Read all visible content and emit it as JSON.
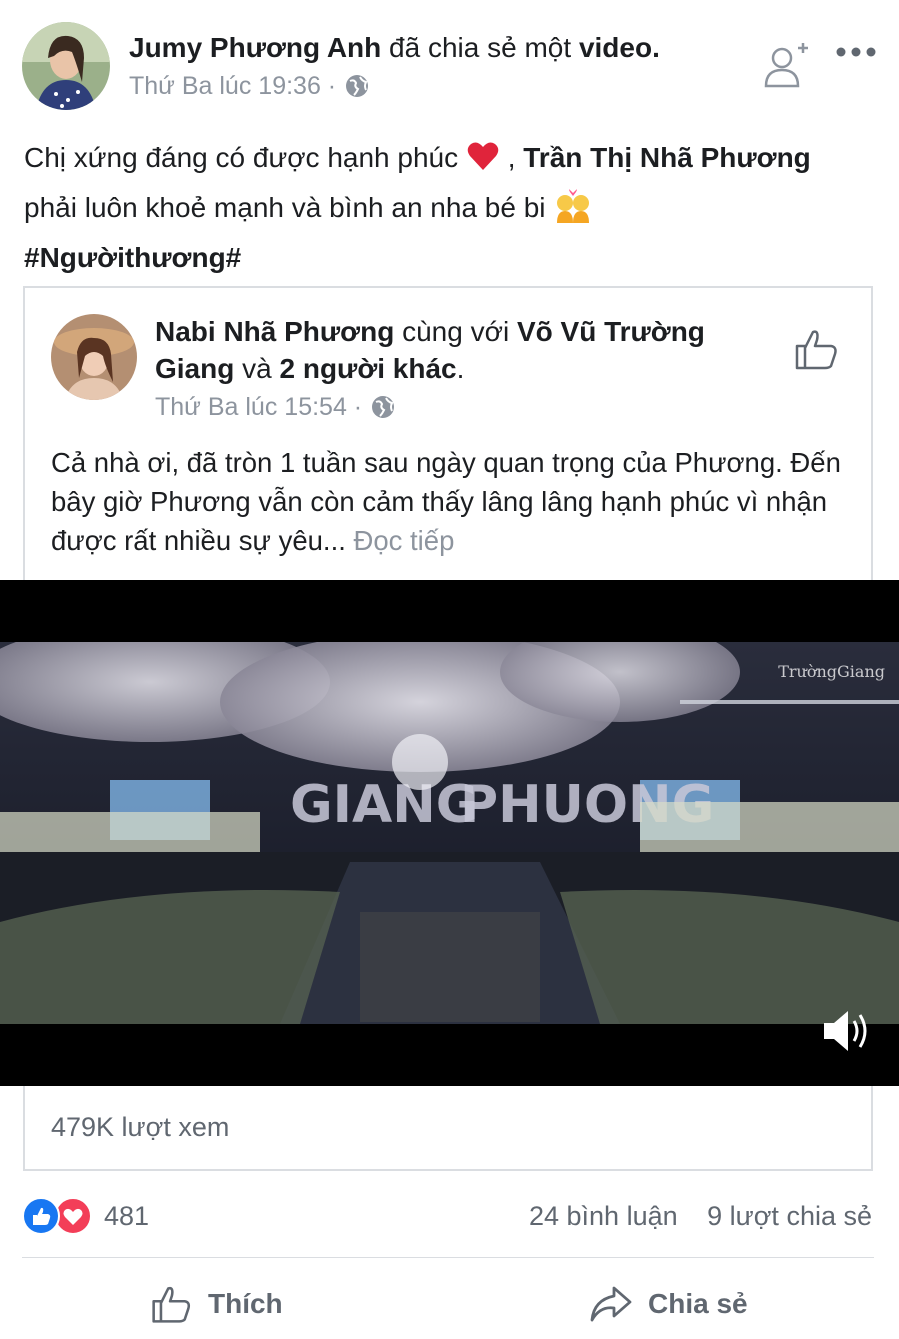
{
  "post": {
    "author": "Jumy Phương Anh",
    "action_text": "đã chia sẻ một",
    "object_text": "video.",
    "time": "Thứ Ba lúc 19:36 ·",
    "text_part1": "Chị xứng đáng có được hạnh phúc",
    "text_part2": ", ",
    "mention": "Trần Thị Nhã Phương",
    "text_part3": " phải luôn khoẻ mạnh và bình an nha bé bi",
    "hashtag": "#Ngườithương#"
  },
  "shared": {
    "author": "Nabi Nhã Phương",
    "with_text": "cùng với",
    "tagged": "Võ Vũ Trường Giang",
    "and_text": "và",
    "others": "2 người khác",
    "period": ".",
    "time": "Thứ Ba lúc 15:54 ·",
    "body": "Cả nhà ơi, đã tròn 1 tuần sau ngày quan trọng của Phương. Đến bây giờ Phương vẫn còn cảm thấy lâng lâng hạnh phúc vì nhận được rất nhiều sự yêu...",
    "see_more": "Đọc tiếp",
    "video_watermark": "TrườngGiang",
    "views": "479K lượt xem"
  },
  "stats": {
    "reactions_count": "481",
    "comments": "24 bình luận",
    "shares": "9 lượt chia sẻ"
  },
  "actions": {
    "like_label": "Thích",
    "share_label": "Chia sẻ"
  },
  "icons": {
    "globe": "globe-icon",
    "add_friend": "add-friend-icon",
    "more": "more-icon",
    "thumbs_up": "thumbs-up-icon",
    "heart": "heart-icon",
    "volume": "volume-icon",
    "share": "share-arrow-icon"
  },
  "colors": {
    "text": "#1c1e21",
    "secondary": "#606770",
    "muted": "#8d949e",
    "like_blue": "#1877f2",
    "love_red": "#f33e58",
    "border": "#dadde1"
  }
}
